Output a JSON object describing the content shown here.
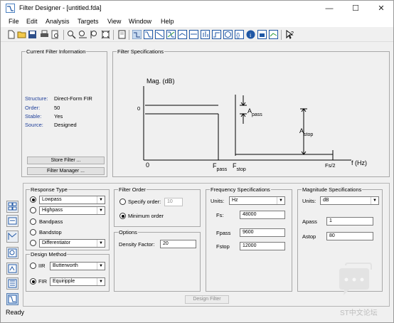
{
  "window": {
    "title": "Filter Designer - [untitled.fda]"
  },
  "menu": [
    "File",
    "Edit",
    "Analysis",
    "Targets",
    "View",
    "Window",
    "Help"
  ],
  "toolbar": {
    "icons": [
      "new-icon",
      "open-icon",
      "save-icon",
      "print-icon",
      "print-preview-icon",
      "zoom-in-icon",
      "zoom-x-icon",
      "zoom-y-icon",
      "full-view-icon",
      "new-figure-icon",
      "filter-specs-icon",
      "magnitude-response-icon",
      "phase-response-icon",
      "mag-phase-icon",
      "group-delay-icon",
      "phase-delay-icon",
      "impulse-response-icon",
      "step-response-icon",
      "pole-zero-icon",
      "filter-coefficients-icon",
      "filter-info-icon",
      "magnitude-spec-icon",
      "legend-icon",
      "whats-this-icon"
    ]
  },
  "current_filter": {
    "title": "Current Filter Information",
    "rows": [
      {
        "label": "Structure:",
        "value": "Direct-Form FIR"
      },
      {
        "label": "Order:",
        "value": "50"
      },
      {
        "label": "Stable:",
        "value": "Yes"
      },
      {
        "label": "Source:",
        "value": "Designed"
      }
    ],
    "store_button": "Store Filter ...",
    "manager_button": "Filter Manager ..."
  },
  "filter_specs": {
    "title": "Filter Specifications",
    "mag_label": "Mag. (dB)",
    "zero_y": "0",
    "zero_x": "0",
    "fpass_main": "F",
    "fpass_sub": "pass",
    "fstop_main": "F",
    "fstop_sub": "stop",
    "fs2": "Fs/2",
    "apass_main": "A",
    "apass_sub": "pass",
    "astop_main": "A",
    "astop_sub": "stop",
    "f_axis": "f (Hz)"
  },
  "response_type": {
    "title": "Response Type",
    "lowpass": "Lowpass",
    "highpass": "Highpass",
    "bandpass": "Bandpass",
    "bandstop": "Bandstop",
    "differentiator": "Differentiator"
  },
  "design_method": {
    "title": "Design Method",
    "iir_label": "IIR",
    "iir_value": "Butterworth",
    "fir_label": "FIR",
    "fir_value": "Equiripple"
  },
  "filter_order": {
    "title": "Filter Order",
    "specify_label": "Specify order:",
    "specify_value": "10",
    "minimum_label": "Minimum order"
  },
  "options": {
    "title": "Options",
    "density_label": "Density Factor:",
    "density_value": "20"
  },
  "freq_specs": {
    "title": "Frequency Specifications",
    "units_label": "Units:",
    "units_value": "Hz",
    "fs_label": "Fs:",
    "fs_value": "48000",
    "fpass_label": "Fpass",
    "fpass_value": "9600",
    "fstop_label": "Fstop",
    "fstop_value": "12000"
  },
  "mag_specs": {
    "title": "Magnitude Specifications",
    "units_label": "Units:",
    "units_value": "dB",
    "apass_label": "Apass",
    "apass_value": "1",
    "astop_label": "Astop",
    "astop_value": "80"
  },
  "design_button": "Design Filter",
  "status": "Ready",
  "watermark": "ST中文论坛"
}
